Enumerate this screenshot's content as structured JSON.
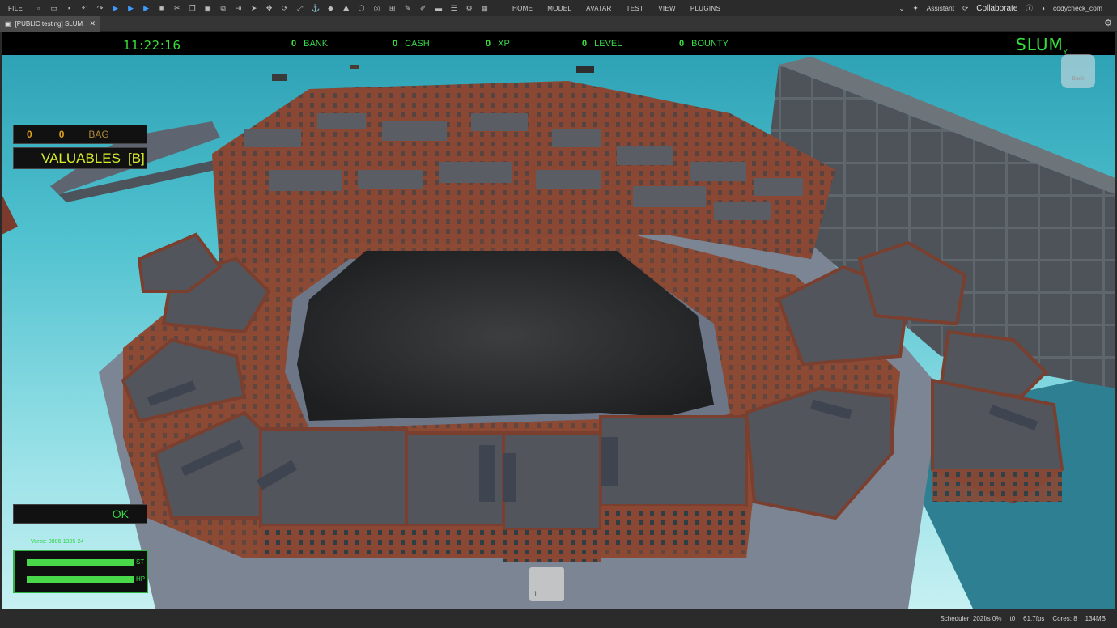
{
  "topbar": {
    "file_label": "FILE",
    "tabs": [
      "HOME",
      "MODEL",
      "AVATAR",
      "TEST",
      "VIEW",
      "PLUGINS"
    ],
    "assistant_label": "Assistant",
    "collaborate_label": "Collaborate",
    "username": "codycheck_com"
  },
  "document_tab": {
    "title": "[PUBLIC testing] SLUM"
  },
  "hud": {
    "time": "11:22:16",
    "stats": [
      {
        "value": "0",
        "label": "BANK"
      },
      {
        "value": "0",
        "label": "CASH"
      },
      {
        "value": "0",
        "label": "XP"
      },
      {
        "value": "0",
        "label": "LEVEL"
      },
      {
        "value": "0",
        "label": "BOUNTY"
      }
    ],
    "logo": "SLUM",
    "logo_sub": "Y",
    "bag": {
      "count_a": "0",
      "count_b": "0",
      "label": "BAG"
    },
    "valuables": {
      "label": "VALUABLES",
      "key": "[B]"
    },
    "status_ok": "OK",
    "version": "Verze: 0806-1305-24",
    "bars": [
      {
        "label": "ST",
        "level": 1.0
      },
      {
        "label": "HP",
        "level": 1.0
      }
    ],
    "hotbar_slot": "1",
    "viewcube_label": "Back"
  },
  "statusbar": {
    "scheduler": "Scheduler: 202f/s 0%",
    "t": "t0",
    "fps": "61.7fps",
    "cores": "Cores: 8",
    "memory": "134MB"
  },
  "colors": {
    "hud_green": "#38e13a",
    "bag_orange": "#e0a11b",
    "valuables_yellow": "#d8f02a",
    "sky": "#4fc1cf",
    "brick": "#8a4b36"
  }
}
